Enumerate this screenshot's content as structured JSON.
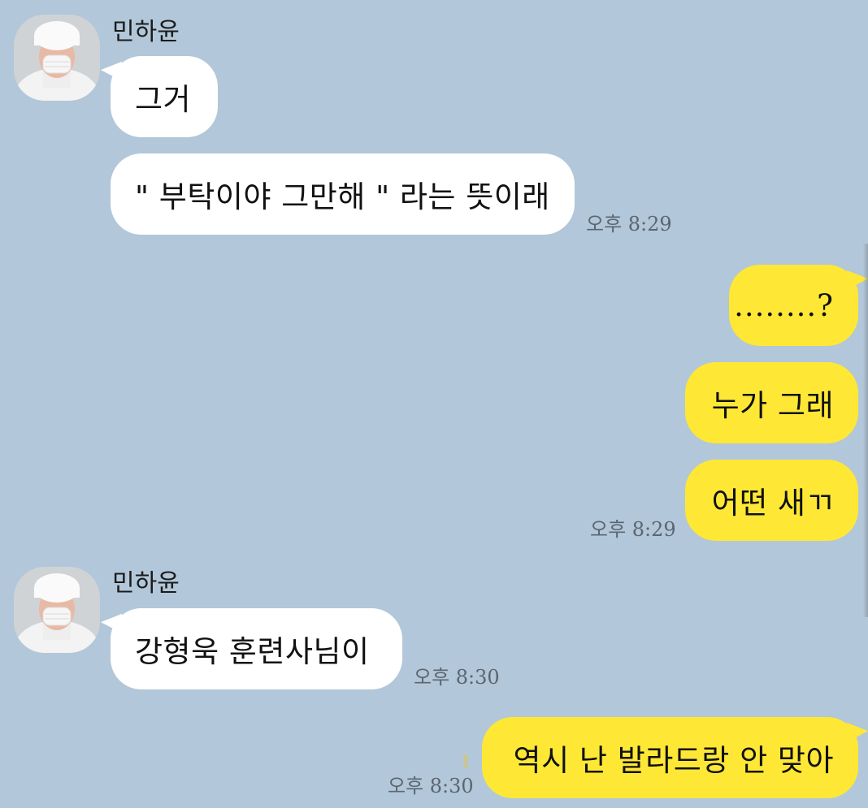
{
  "chat": {
    "sender_1": {
      "name": "민하윤",
      "messages": [
        "그거",
        "\" 부탁이야 그만해 \" 라는 뜻이래"
      ],
      "time": "오후 8:29"
    },
    "me_1": {
      "messages": [
        "........?",
        "누가 그래",
        "어떤 새ㄲ"
      ],
      "time": "오후 8:29"
    },
    "sender_2": {
      "name": "민하윤",
      "messages": [
        "강형욱 훈련사님이"
      ],
      "time": "오후 8:30"
    },
    "me_2": {
      "messages": [
        "역시 난 발라드랑 안 맞아"
      ],
      "time": "오후 8:30",
      "unread_count": "1"
    }
  },
  "colors": {
    "background": "#b2c7d9",
    "my_bubble": "#fee835",
    "their_bubble": "#ffffff",
    "timestamp": "#5b6670",
    "unread": "#e8c33c"
  }
}
